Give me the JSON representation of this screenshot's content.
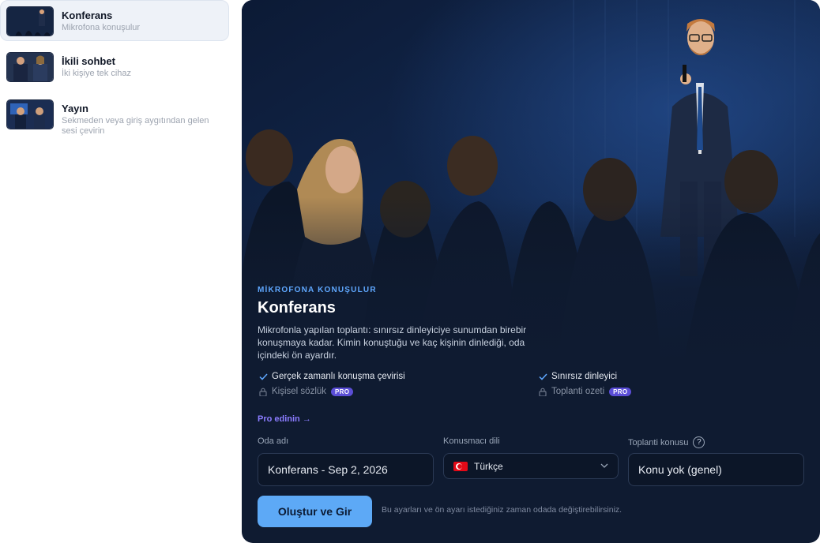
{
  "sidebar": {
    "items": [
      {
        "title": "Konferans",
        "subtitle": "Mikrofona konuşulur",
        "active": true
      },
      {
        "title": "İkili sohbet",
        "subtitle": "İki kişiye tek cihaz",
        "active": false
      },
      {
        "title": "Yayın",
        "subtitle": "Sekmeden veya giriş aygıtından gelen sesi çevirin",
        "active": false
      }
    ]
  },
  "main": {
    "eyebrow": "MİKROFONA KONUŞULUR",
    "title": "Konferans",
    "description": "Mikrofonla yapılan toplantı: sınırsız dinleyiciye sunumdan birebir konuşmaya kadar. Kimin konuştuğu ve kaç kişinin dinlediği, oda içindeki ön ayardır.",
    "features": [
      {
        "label": "Gerçek zamanlı konuşma çevirisi",
        "icon": "check-icon",
        "locked": false
      },
      {
        "label": "Sınırsız dinleyici",
        "icon": "check-icon",
        "locked": false
      },
      {
        "label": "Kişisel sözlük",
        "icon": "lock-icon",
        "locked": true,
        "badge": "PRO"
      },
      {
        "label": "Toplanti ozeti",
        "icon": "lock-icon",
        "locked": true,
        "badge": "PRO"
      }
    ],
    "get_pro_label": "Pro edinin →",
    "form": {
      "room_name_label": "Oda adı",
      "room_name_value": "Konferans - Sep 2, 2026",
      "speaker_lang_label": "Konusmacı dili",
      "speaker_lang_value": "Türkçe",
      "topic_label": "Toplanti konusu",
      "topic_value": "Konu yok (genel)"
    },
    "submit_label": "Oluştur ve Gir",
    "hint": "Bu ayarları ve ön ayarı istediğiniz zaman odada değiştirebilirsiniz.",
    "colors": {
      "accent": "#5da9f6",
      "pro": "#5b4ed6",
      "card_bg": "#0f1b31"
    }
  }
}
